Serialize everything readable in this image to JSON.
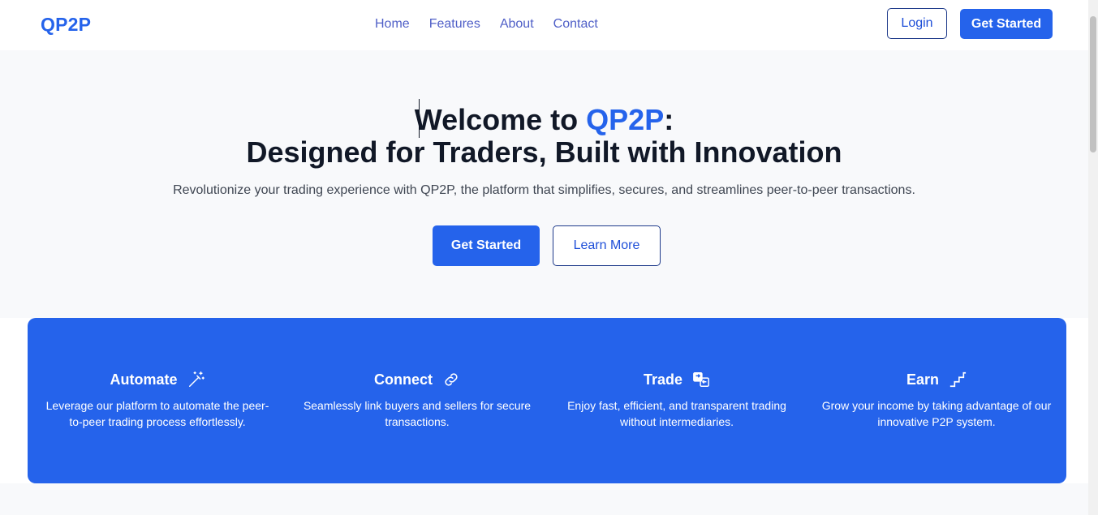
{
  "nav": {
    "logo": "QP2P",
    "links": [
      "Home",
      "Features",
      "About",
      "Contact"
    ],
    "login_label": "Login",
    "get_started_label": "Get Started"
  },
  "hero": {
    "title_prefix": "Welcome to ",
    "title_brand": "QP2P",
    "title_colon": ":",
    "title_line2": "Designed for Traders, Built with Innovation",
    "subtitle": "Revolutionize your trading experience with QP2P, the platform that simplifies, secures, and streamlines peer-to-peer transactions.",
    "primary_label": "Get Started",
    "secondary_label": "Learn More"
  },
  "features": [
    {
      "title": "Automate",
      "icon": "magic-wand-icon",
      "desc": "Leverage our platform to automate the peer-to-peer trading process effortlessly."
    },
    {
      "title": "Connect",
      "icon": "link-icon",
      "desc": "Seamlessly link buyers and sellers for secure transactions."
    },
    {
      "title": "Trade",
      "icon": "exchange-icon",
      "desc": "Enjoy fast, efficient, and transparent trading without intermediaries."
    },
    {
      "title": "Earn",
      "icon": "stairs-icon",
      "desc": "Grow your income by taking advantage of our innovative P2P system."
    }
  ],
  "colors": {
    "brand": "#2563eb",
    "heading": "#111827",
    "background": "#f8f9fb"
  }
}
